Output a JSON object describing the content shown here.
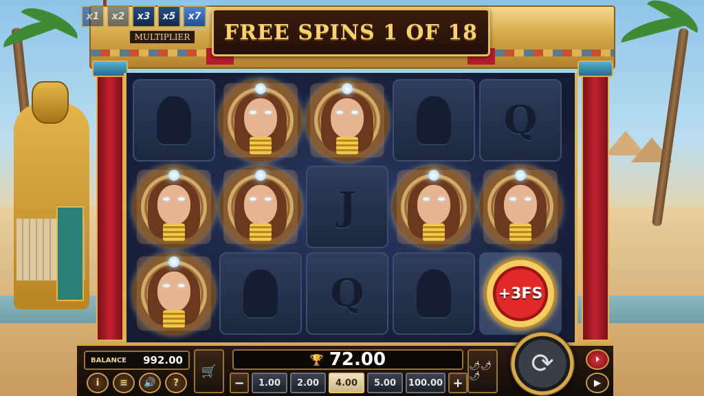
{
  "header": {
    "title": "FREE SPINS 1 OF 18"
  },
  "multiplier": {
    "label": "MULTIPLIER",
    "options": [
      {
        "text": "x1",
        "state": "dim"
      },
      {
        "text": "x2",
        "state": "dim"
      },
      {
        "text": "x3",
        "state": "normal"
      },
      {
        "text": "x5",
        "state": "normal"
      },
      {
        "text": "x7",
        "state": "active"
      }
    ]
  },
  "reels": {
    "grid": [
      [
        "anubis",
        "queen",
        "queen",
        "horus",
        "Q"
      ],
      [
        "queen",
        "queen",
        "J",
        "queen",
        "queen"
      ],
      [
        "queen",
        "pharaoh",
        "Q",
        "pharaoh",
        "bonus_3fs"
      ]
    ],
    "bonus_label": "+3FS"
  },
  "panel": {
    "balance_label": "BALANCE",
    "balance_value": "992.00",
    "win_value": "72.00",
    "bet_options": [
      "1.00",
      "2.00",
      "4.00",
      "5.00",
      "100.00"
    ],
    "selected_bet": "4.00",
    "minus_label": "−",
    "plus_label": "+",
    "info_label": "i",
    "menu_label": "≡",
    "sound_label": "🔊",
    "help_label": "?",
    "cart_label": "🛒",
    "turbo_label": "🌶🌶🌶",
    "spin_label": "⟳",
    "play_label": "▶"
  },
  "colors": {
    "accent_gold": "#e6bf5c",
    "banner_text": "#f7d270",
    "selected_bet_bg": "#efe3c4"
  }
}
